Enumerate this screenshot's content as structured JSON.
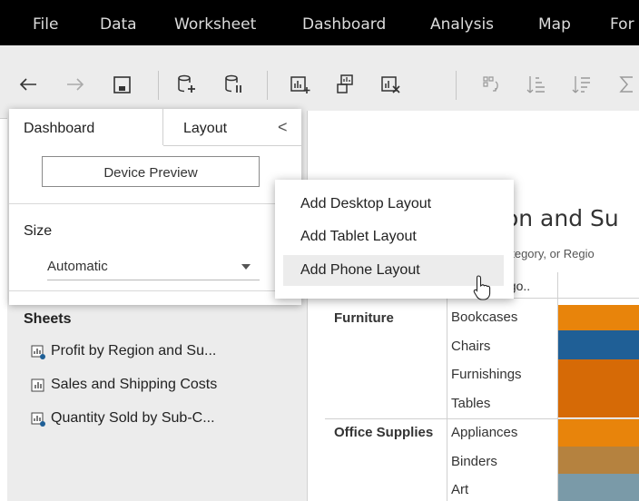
{
  "menubar": {
    "items": [
      "File",
      "Data",
      "Worksheet",
      "Dashboard",
      "Analysis",
      "Map",
      "For"
    ]
  },
  "toolbar": {
    "icons": [
      "back-arrow-icon",
      "forward-arrow-icon",
      "save-icon",
      "new-data-source-icon",
      "pause-updates-icon",
      "new-worksheet-icon",
      "new-dashboard-icon",
      "clear-sheet-icon",
      "swap-rows-columns-icon",
      "sort-ascending-icon",
      "sort-descending-icon",
      "totals-icon"
    ]
  },
  "dashboard_panel": {
    "tab_dashboard": "Dashboard",
    "tab_layout": "Layout",
    "collapse_glyph": "<",
    "device_preview_button": "Device Preview",
    "size_label": "Size",
    "size_value": "Automatic"
  },
  "device_dropdown": {
    "items": [
      "Add Desktop Layout",
      "Add Tablet Layout",
      "Add Phone Layout"
    ],
    "highlighted_index": 2
  },
  "sheets": {
    "title": "Sheets",
    "items": [
      {
        "label": "Profit by Region and Su...",
        "icon": "sheet-used-icon"
      },
      {
        "label": "Sales and Shipping Costs",
        "icon": "sheet-icon"
      },
      {
        "label": "Quantity Sold by Sub-C...",
        "icon": "sheet-used-icon"
      }
    ]
  },
  "canvas": {
    "title_fragment": "ion and Su",
    "subtitle_fragment": "ategory, or Regio",
    "header_fragment": "ego..",
    "categories": [
      "Furniture",
      "Office Supplies"
    ],
    "subcategories": [
      "Bookcases",
      "Chairs",
      "Furnishings",
      "Tables",
      "Appliances",
      "Binders",
      "Art"
    ]
  },
  "colors": {
    "orange": "#e8840b",
    "dark_orange": "#d66a06",
    "blue": "#1f5f96",
    "tan": "#b5823f",
    "steel": "#7a9aa8",
    "menubar": "#000000"
  }
}
